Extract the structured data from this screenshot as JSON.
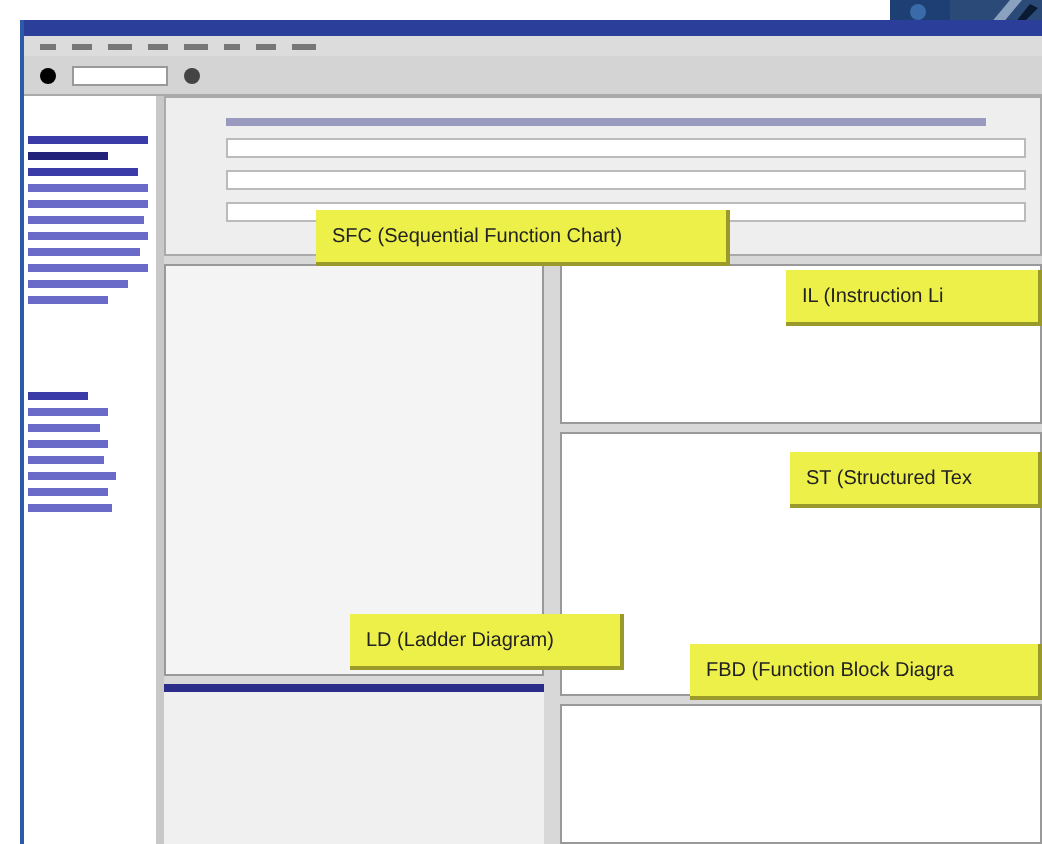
{
  "callouts": [
    {
      "label": "SFC (Sequential Function Chart)"
    },
    {
      "label": "IL (Instruction Li"
    },
    {
      "label": "ST (Structured Tex"
    },
    {
      "label": "LD (Ladder Diagram)"
    },
    {
      "label": "FBD (Function Block Diagra"
    }
  ]
}
